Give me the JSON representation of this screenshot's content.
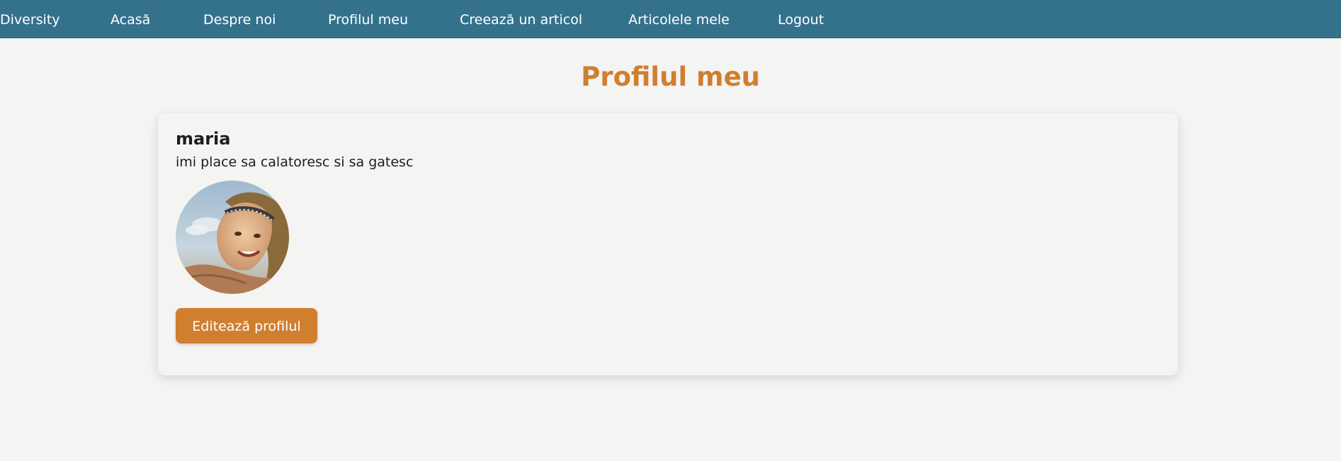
{
  "nav": {
    "items": [
      {
        "label": "Diversity"
      },
      {
        "label": "Acasă"
      },
      {
        "label": "Despre noi"
      },
      {
        "label": "Profilul meu"
      },
      {
        "label": "Creează un articol"
      },
      {
        "label": "Articolele mele"
      },
      {
        "label": "Logout"
      }
    ]
  },
  "page": {
    "title": "Profilul meu"
  },
  "profile": {
    "username": "maria",
    "bio": "imi place sa calatoresc si sa gatesc",
    "avatar_icon": "profile-photo",
    "edit_label": "Editează profilul"
  },
  "colors": {
    "navbar": "#34728c",
    "accent": "#d07f30",
    "background": "#f4f4f2"
  }
}
